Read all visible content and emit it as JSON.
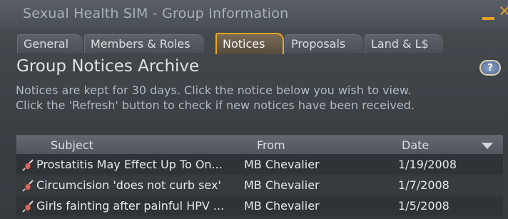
{
  "window": {
    "title": "Sexual Health SIM - Group Information",
    "close_glyph": "×"
  },
  "tabs": [
    {
      "label": "General"
    },
    {
      "label": "Members & Roles"
    },
    {
      "label": "Notices"
    },
    {
      "label": "Proposals"
    },
    {
      "label": "Land & L$"
    }
  ],
  "active_tab": "Notices",
  "panel": {
    "title": "Group Notices Archive",
    "help_label": "?",
    "description_line1": "Notices are kept for 30 days. Click the notice below you wish to view.",
    "description_line2": "Click the 'Refresh' button to check if new notices have been received."
  },
  "table": {
    "columns": {
      "subject": "Subject",
      "from": "From",
      "date": "Date"
    },
    "rows": [
      {
        "subject": "Prostatitis May Effect Up To On...",
        "from": "MB Chevalier",
        "date": "1/19/2008"
      },
      {
        "subject": "Circumcision 'does not curb sex'",
        "from": "MB Chevalier",
        "date": "1/7/2008"
      },
      {
        "subject": "Girls fainting after painful HPV ...",
        "from": "MB Chevalier",
        "date": "1/5/2008"
      }
    ]
  },
  "colors": {
    "accent": "#e8a524",
    "background": "#3b3f44"
  },
  "icons": {
    "minimize": "minimize-icon",
    "close": "close-icon",
    "help": "help-icon",
    "notice": "notice-icon",
    "sort": "sort-descending-icon"
  }
}
